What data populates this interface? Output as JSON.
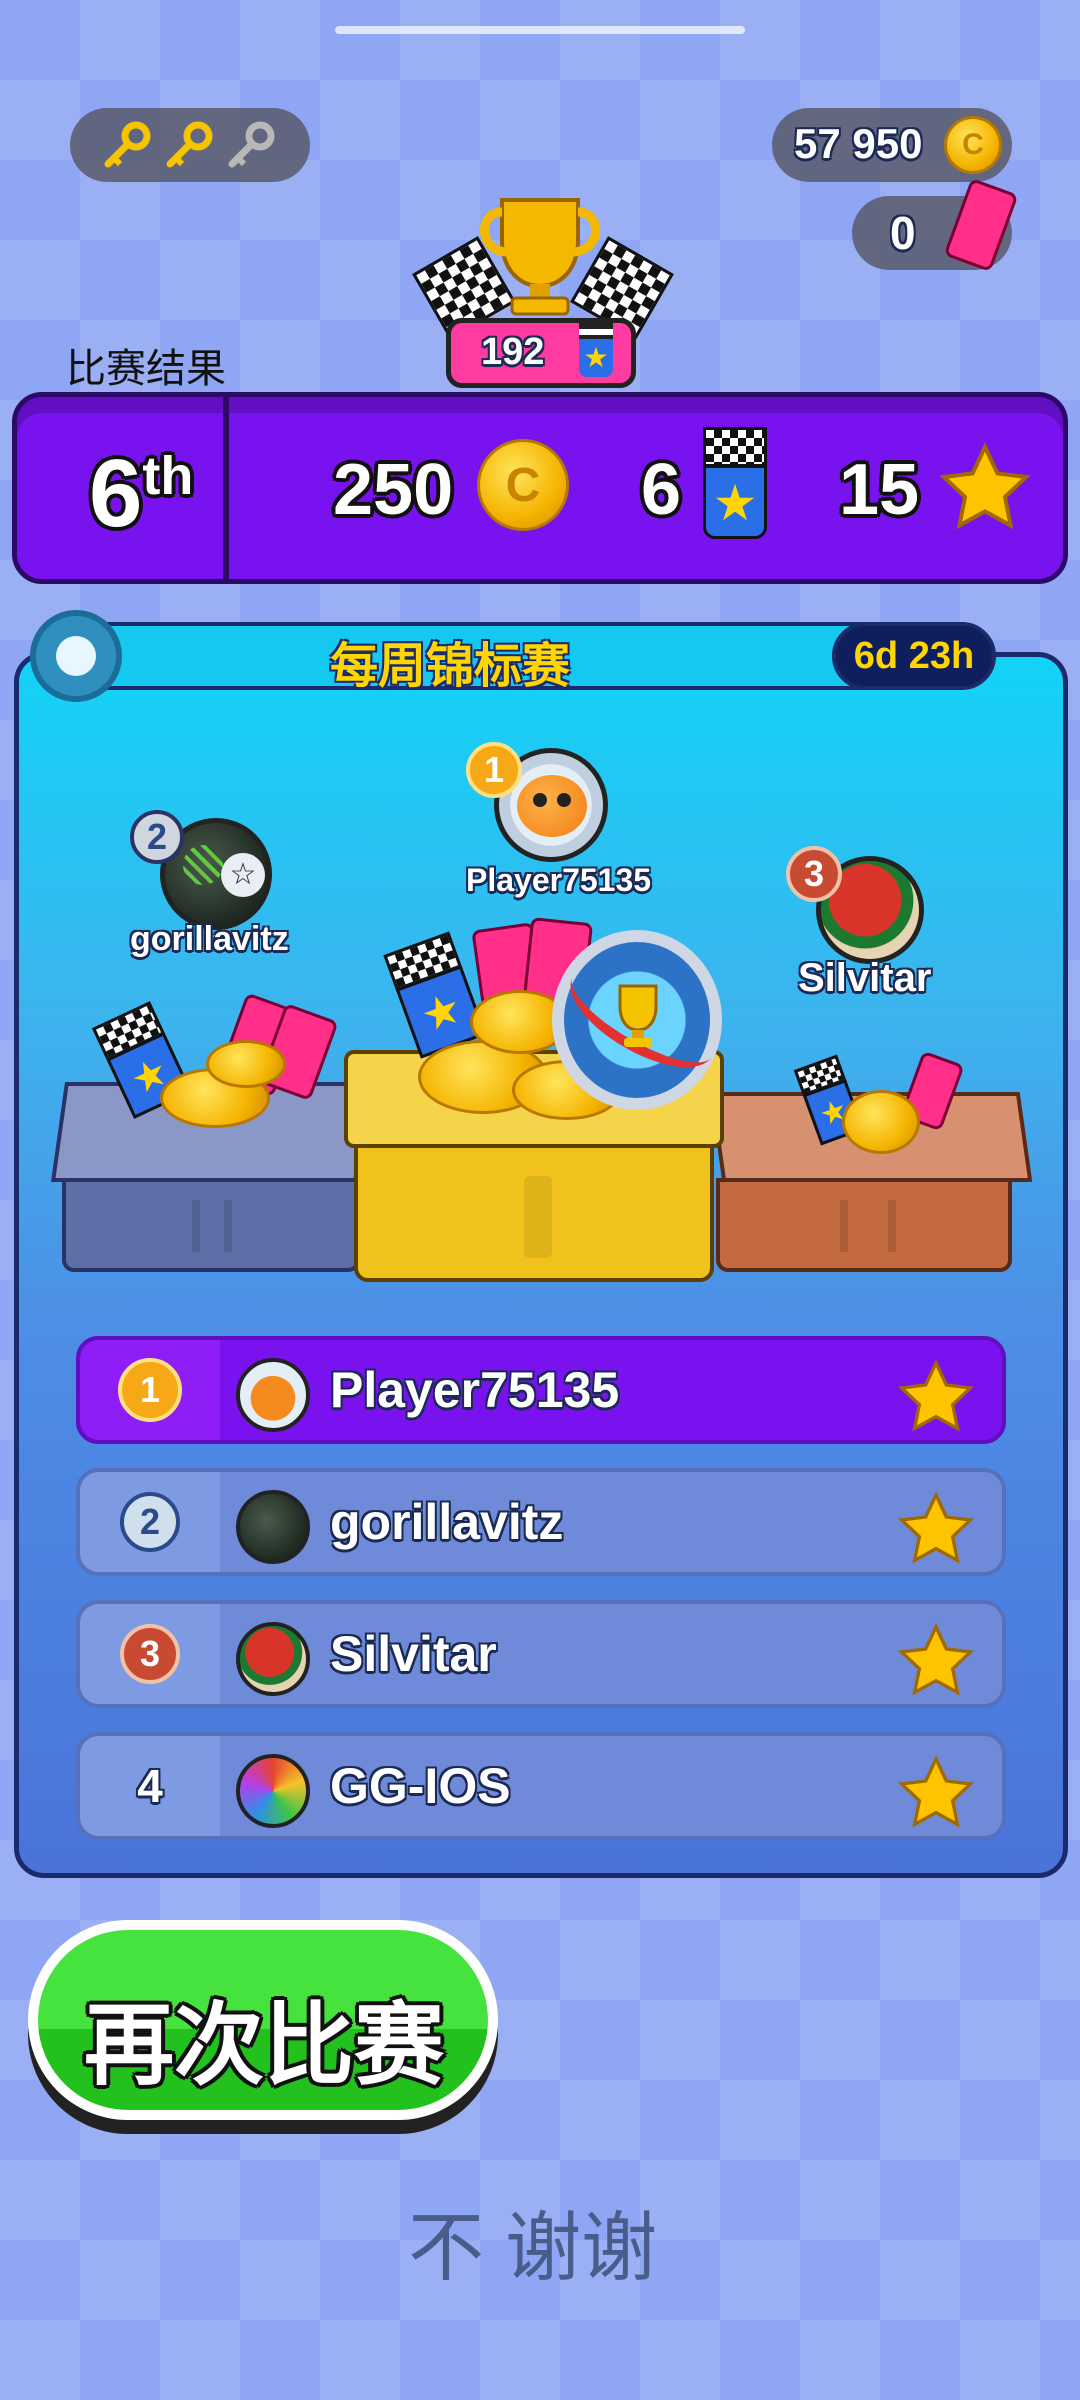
{
  "hud": {
    "keys": [
      {
        "icon": "gold-key-icon",
        "active": true
      },
      {
        "icon": "gold-key-icon",
        "active": true
      },
      {
        "icon": "grey-key-icon",
        "active": false
      }
    ],
    "coins_balance": "57 950",
    "tickets_balance": "0",
    "trophy_medals": "192"
  },
  "results": {
    "heading": "比赛结果",
    "place": "6",
    "place_suffix": "th",
    "reward_coins": "250",
    "reward_medals": "6",
    "reward_stars": "15"
  },
  "tournament": {
    "title": "每周锦标赛",
    "timer": "6d 23h",
    "podium": [
      {
        "rank": "1",
        "name": "Player75135"
      },
      {
        "rank": "2",
        "name": "gorillavitz"
      },
      {
        "rank": "3",
        "name": "Silvitar"
      }
    ],
    "leaderboard": [
      {
        "rank": "1",
        "name": "Player75135"
      },
      {
        "rank": "2",
        "name": "gorillavitz"
      },
      {
        "rank": "3",
        "name": "Silvitar"
      },
      {
        "rank": "4",
        "name": "GG-IOS"
      }
    ]
  },
  "actions": {
    "play_again": "再次比赛",
    "no_thanks": "不 谢谢"
  },
  "colors": {
    "accent_purple": "#7a12f0",
    "row_blue": "#6f8ad8",
    "panel_cyan": "#12d0f5",
    "button_green": "#2fd12a"
  }
}
